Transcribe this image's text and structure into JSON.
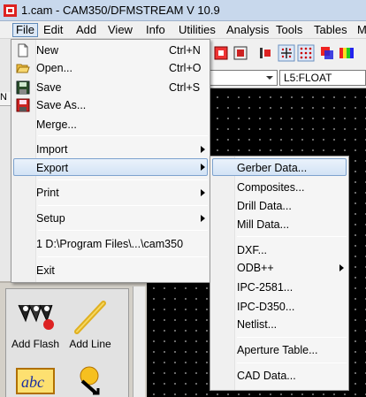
{
  "window": {
    "title": "1.cam - CAM350/DFMSTREAM V 10.9"
  },
  "menubar": [
    {
      "key": "file",
      "label": "File"
    },
    {
      "key": "edit",
      "label": "Edit"
    },
    {
      "key": "add",
      "label": "Add"
    },
    {
      "key": "view",
      "label": "View"
    },
    {
      "key": "info",
      "label": "Info"
    },
    {
      "key": "utilities",
      "label": "Utilities"
    },
    {
      "key": "analysis",
      "label": "Analysis"
    },
    {
      "key": "tools",
      "label": "Tools"
    },
    {
      "key": "tables",
      "label": "Tables"
    },
    {
      "key": "more",
      "label": "M"
    }
  ],
  "layer_combo": {
    "value": "L5:FLOAT"
  },
  "left_strip": {
    "label": "N"
  },
  "file_menu": {
    "items": [
      {
        "label": "New",
        "shortcut": "Ctrl+N",
        "icon": "new-file-icon"
      },
      {
        "label": "Open...",
        "shortcut": "Ctrl+O",
        "icon": "open-folder-icon"
      },
      {
        "label": "Save",
        "shortcut": "Ctrl+S",
        "icon": "save-disk-icon"
      },
      {
        "label": "Save As...",
        "shortcut": "",
        "icon": "save-as-icon"
      },
      {
        "label": "Merge...",
        "shortcut": ""
      },
      {
        "label": "Import",
        "submenu": true
      },
      {
        "label": "Export",
        "submenu": true,
        "highlighted": true
      },
      {
        "label": "Print",
        "submenu": true
      },
      {
        "label": "Setup",
        "submenu": true
      },
      {
        "label": "1  D:\\Program Files\\...\\cam350"
      },
      {
        "label": "Exit"
      }
    ]
  },
  "export_menu": {
    "items": [
      {
        "label": "Gerber Data...",
        "highlighted": true
      },
      {
        "label": "Composites..."
      },
      {
        "label": "Drill Data..."
      },
      {
        "label": "Mill Data..."
      },
      {
        "label": "DXF..."
      },
      {
        "label": "ODB++",
        "submenu": true
      },
      {
        "label": "IPC-2581..."
      },
      {
        "label": "IPC-D350..."
      },
      {
        "label": "Netlist..."
      },
      {
        "label": "Aperture Table..."
      },
      {
        "label": "CAD Data..."
      }
    ]
  },
  "tool_panel": {
    "tools": [
      {
        "label": "Add Flash",
        "icon": "add-flash-icon"
      },
      {
        "label": "Add Line",
        "icon": "add-line-icon"
      },
      {
        "label": "abc",
        "icon": "add-text-icon"
      },
      {
        "label": "",
        "icon": "add-polygon-icon"
      }
    ]
  },
  "colors": {
    "menu_highlight": "#d3e3f5",
    "titlebar": "#c8d8ec",
    "canvas": "#000000"
  }
}
